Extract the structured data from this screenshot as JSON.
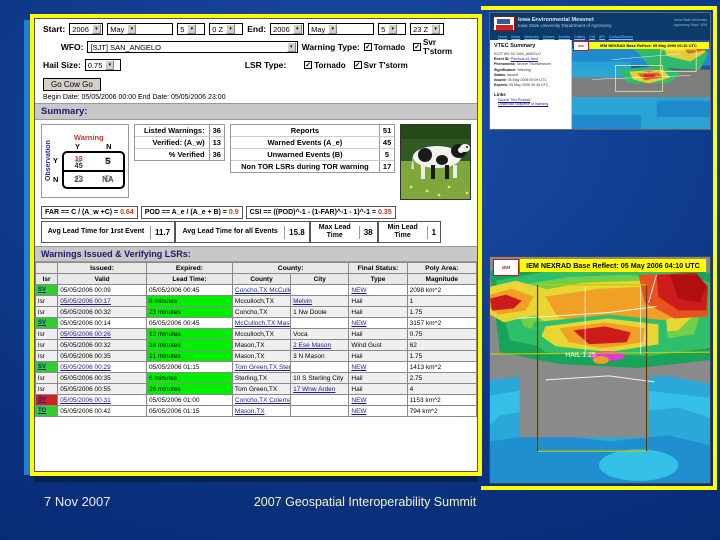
{
  "footer": {
    "date": "7 Nov 2007",
    "title": "2007 Geospatial Interoperability Summit"
  },
  "browser": {
    "form": {
      "start_label": "Start:",
      "start_year": "2006",
      "start_month": "May",
      "start_day": "5",
      "start_hour": "0 Z",
      "end_label": "End:",
      "end_year": "2006",
      "end_month": "May",
      "end_day": "5",
      "end_hour": "23 Z",
      "wfo_label": "WFO:",
      "wfo_value": "[SJT] SAN_ANGELO",
      "hail_label": "Hail Size:",
      "hail_value": "0.75",
      "warning_type_label": "Warning Type:",
      "lsr_type_label": "LSR Type:",
      "tornado_label": "Tornado",
      "svr_tstorm_label": "Svr T'storm",
      "go_button": "Go Cow Go",
      "date_note": "Begin Date: 05/05/2006 00:00 End Date: 05/05/2006 23:00"
    },
    "summary_label": "Summary:",
    "contingency": {
      "title": "Warning",
      "axis": "Observation",
      "col_y": "Y",
      "col_n": "N",
      "row_y": "Y",
      "row_n": "N",
      "cell_yy_red": "13",
      "cell_yy_blue": "45",
      "cell_yn": "5",
      "cell_yn_ghost": "B",
      "cell_ny": "23",
      "cell_ny_ghost": "C",
      "cell_nn": "NA",
      "cell_nn_ghost": "D"
    },
    "listed_table": {
      "rows": [
        {
          "key": "Listed Warnings:",
          "value": "36"
        },
        {
          "key": "Verified: (A_w)",
          "value": "13"
        },
        {
          "key": "% Verified",
          "value": "36"
        }
      ]
    },
    "reports_table": {
      "rows": [
        {
          "key": "Reports",
          "value": "51"
        },
        {
          "key": "Warned Events (A_e)",
          "value": "45"
        },
        {
          "key": "Unwarned Events (B)",
          "value": "5"
        },
        {
          "key": "Non TOR LSRs during TOR warning",
          "value": "17"
        }
      ]
    },
    "formulas": [
      {
        "text": "FAR == C / (A_w +C) = ",
        "value": "0.64"
      },
      {
        "text": "POD == A_e / (A_e + B) = ",
        "value": "0.9"
      },
      {
        "text": "CSI == ((POD)^-1 - (1-FAR)^-1 - 1)^-1 = ",
        "value": "0.35"
      }
    ],
    "lead_times": [
      {
        "label": "Avg Lead Time for 1rst Event",
        "value": "11.7"
      },
      {
        "label": "Avg Lead Time for all Events",
        "value": "15.8"
      },
      {
        "label": "Max Lead Time",
        "value": "38"
      },
      {
        "label": "Min Lead Time",
        "value": "1"
      }
    ],
    "warnings_title": "Warnings Issued & Verifying LSRs:",
    "table": {
      "header_group": {
        "blank": "",
        "issued": "Issued:",
        "expired": "Expired:",
        "county": "County:",
        "final_status": "Final Status:",
        "poly_area": "Poly Area:"
      },
      "header_cols": [
        "lsr",
        "Valid",
        "Lead Time:",
        "County",
        "City",
        "Type",
        "Magnitude"
      ],
      "rows": [
        {
          "tag": "SV",
          "tag_kind": "warn",
          "valid": "05/05/2006 00:09",
          "lead": "05/05/2006 00:45",
          "lead_kind": "plain",
          "county": "Concho,TX McCulloch,TX",
          "city": "",
          "type": "NEW",
          "mag": "2098 km^2"
        },
        {
          "tag": "lsr",
          "tag_kind": "lsr",
          "valid": "05/05/2006 00:17",
          "lead": "8 minutes",
          "lead_kind": "green",
          "county": "Mcculloch,TX",
          "city": "Melvin",
          "type": "Hail",
          "mag": "1"
        },
        {
          "tag": "lsr",
          "tag_kind": "lsr",
          "valid": "05/05/2006 00:32",
          "lead": "23 minutes",
          "lead_kind": "green",
          "county": "Concho,TX",
          "city": "1 Nw Doole",
          "type": "Hail",
          "mag": "1.75"
        },
        {
          "tag": "SV",
          "tag_kind": "warn",
          "valid": "05/05/2006 00:14",
          "lead": "05/05/2006 00:45",
          "lead_kind": "plain",
          "county": "McCulloch,TX Mason,TX San Saba,TX",
          "city": "",
          "type": "NEW",
          "mag": "3157 km^2"
        },
        {
          "tag": "lsr",
          "tag_kind": "lsr",
          "valid": "05/05/2006 00:26",
          "lead": "12 minutes",
          "lead_kind": "green",
          "county": "Mcculloch,TX",
          "city": "Voca",
          "type": "Hail",
          "mag": "0.75"
        },
        {
          "tag": "lsr",
          "tag_kind": "lsr",
          "valid": "05/05/2006 00:32",
          "lead": "18 minutes",
          "lead_kind": "green",
          "county": "Mason,TX",
          "city": "2 Ese Mason",
          "type": "Wind Gust",
          "mag": "62"
        },
        {
          "tag": "lsr",
          "tag_kind": "lsr",
          "valid": "05/05/2006 00:35",
          "lead": "21 minutes",
          "lead_kind": "green",
          "county": "Mason,TX",
          "city": "3 N Mason",
          "type": "Hail",
          "mag": "1.75"
        },
        {
          "tag": "SV",
          "tag_kind": "warn",
          "valid": "05/05/2006 00:29",
          "lead": "05/05/2006 01:15",
          "lead_kind": "plain",
          "county": "Tom Green,TX Sterling,TX",
          "city": "",
          "type": "NEW",
          "mag": "1413 km^2"
        },
        {
          "tag": "lsr",
          "tag_kind": "lsr",
          "valid": "05/05/2006 00:35",
          "lead": "6 minutes",
          "lead_kind": "green",
          "county": "Sterling,TX",
          "city": "10 S Sterling City",
          "type": "Hail",
          "mag": "2.75"
        },
        {
          "tag": "lsr",
          "tag_kind": "lsr",
          "valid": "05/05/2006 00:55",
          "lead": "26 minutes",
          "lead_kind": "green",
          "county": "Tom Green,TX",
          "city": "17 Wnw Arden",
          "type": "Hail",
          "mag": "4"
        },
        {
          "tag": "SV",
          "tag_kind": "warnred",
          "valid": "05/05/2006 00:31",
          "lead": "05/05/2006 01:00",
          "lead_kind": "plain",
          "county": "Concho,TX Coleman,TX McCulloch,TX Brown,TX",
          "city": "",
          "type": "NEW",
          "mag": "1153 km^2"
        },
        {
          "tag": "TO",
          "tag_kind": "tor",
          "valid": "05/05/2006 00:42",
          "lead": "05/05/2006 01:15",
          "lead_kind": "plain",
          "county": "Mason,TX",
          "city": "",
          "type": "NEW",
          "mag": "794 km^2"
        }
      ]
    }
  },
  "iem_page": {
    "site_title": "Iowa Environmental Mesonet",
    "site_subtitle": "Iowa State University Department of Agronomy",
    "corner_line1": "Iowa State University",
    "corner_line2": "Agronomy Dept / IEM",
    "nav": [
      "Home",
      "News",
      "Networks",
      "Current",
      "Archive",
      "Gallery",
      "GIS",
      "API",
      "Contact/Search"
    ],
    "panel_title": "VTEC Summary",
    "details": [
      {
        "k": "",
        "v": "KSJT WS.SV SAN_ANGELO"
      },
      {
        "k": "Event ID:",
        "v": "Previous  #1  Next"
      },
      {
        "k": "Phenomena:",
        "v": "Severe Thunderstorm"
      },
      {
        "k": "Significance:",
        "v": "Warning"
      },
      {
        "k": "Status:",
        "v": "Issued"
      },
      {
        "k": "Issued:",
        "v": "05 May 2006 00:09 UTC"
      },
      {
        "k": "Expires:",
        "v": "05 May 2006 00:45 UTC"
      }
    ],
    "links_header": "Links",
    "links": [
      "Source Text Product",
      "Download Shapefile of Warning"
    ],
    "map_caption": "IEM NEXRAD Base Reflect: 05 May 2006 00:10 UTC",
    "map_logo": "IEM"
  },
  "nexrad": {
    "caption": "IEM NEXRAD Base Reflect: 05 May 2006 04:10 UTC",
    "logo": "IEM",
    "annotation": "HAIL 1.25"
  },
  "colors": {
    "frame_yellow": "#ffff00",
    "slide_blue": "#0b3380",
    "lead_green": "#00ee00",
    "warn_green": "#33cc33",
    "warn_red": "#cc2222",
    "link_blue": "#1a1a8c",
    "accent_red": "#c0392b"
  }
}
